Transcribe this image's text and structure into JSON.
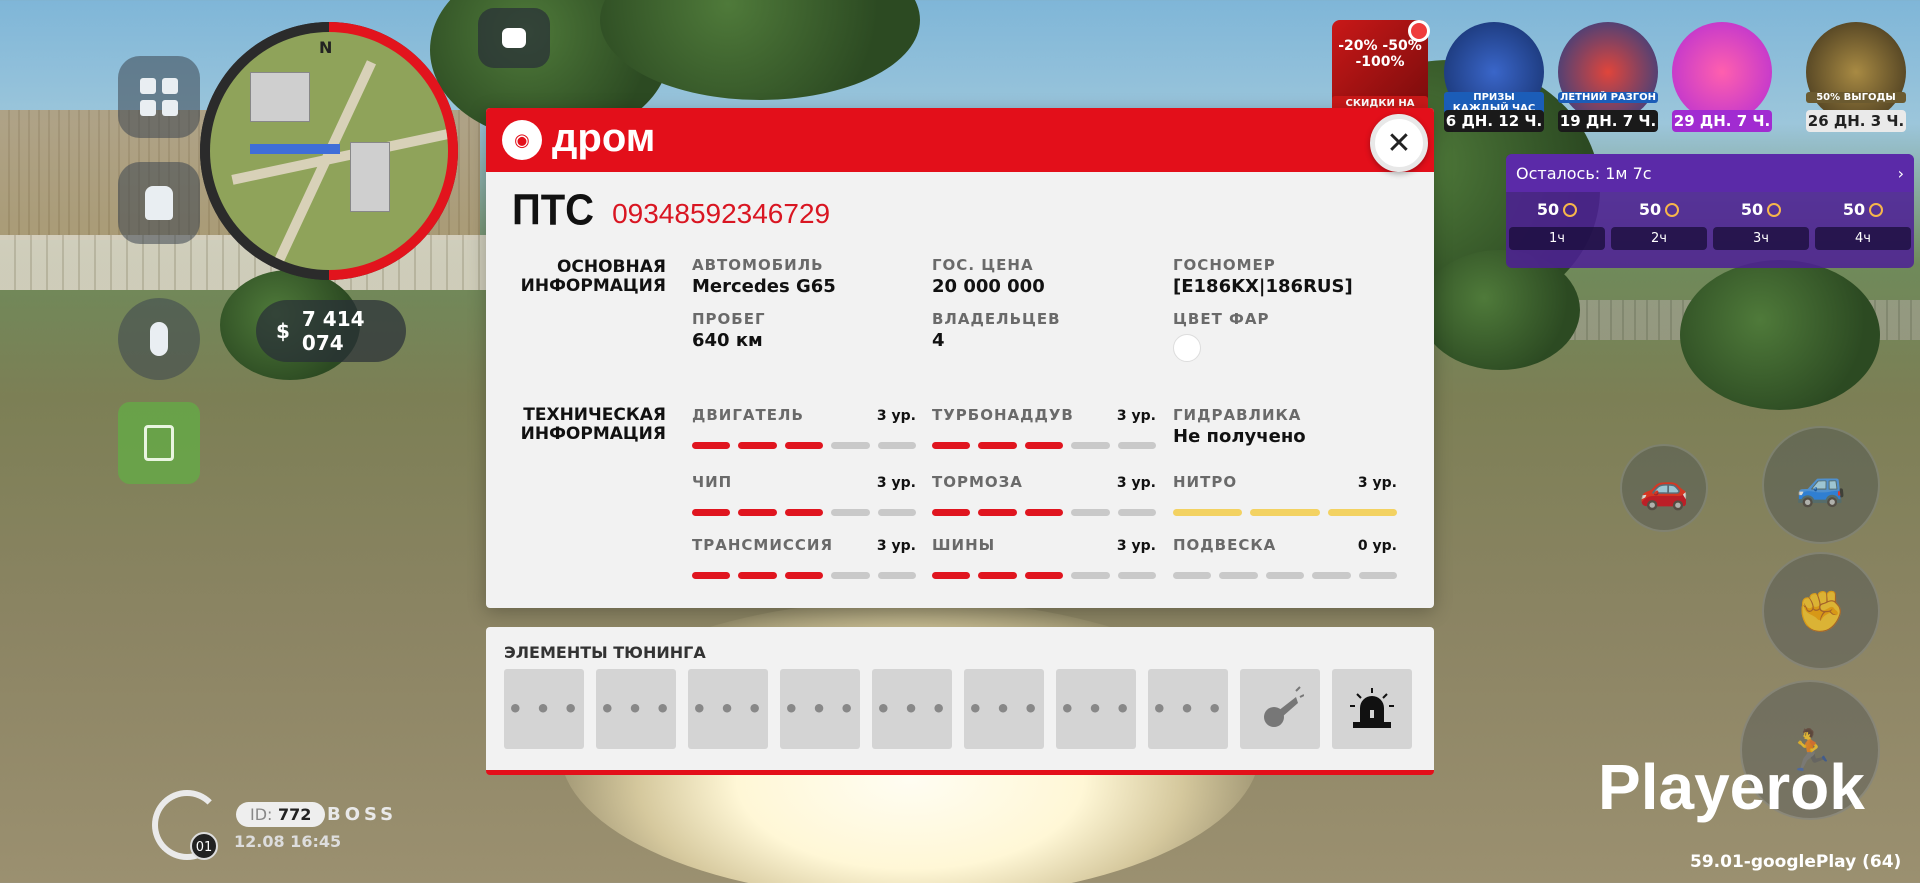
{
  "hud": {
    "money": "7 414 074",
    "money_symbol": "$",
    "minimap_north": "N",
    "player_id_label": "ID:",
    "player_id": "772",
    "player_name": "BOSS",
    "player_level": "01",
    "datetime": "12.08 16:45",
    "watermark": "Playerok",
    "version": "59.01-googlePlay (64)"
  },
  "events": [
    {
      "label": "СКИДКИ НА КЕЙСЫ",
      "promo": "-20% -50% -100%"
    },
    {
      "label": "ПРИЗЫ КАЖДЫЙ ЧАС",
      "time": "6 ДН. 12 Ч.",
      "color": "#1b3f8a"
    },
    {
      "label": "ЛЕТНИЙ РАЗГОН",
      "time": "19 ДН. 7 Ч.",
      "color": "#1b5db8"
    },
    {
      "label": "",
      "time": "29 ДН. 7 Ч.",
      "color": "#c53bd9"
    },
    {
      "label": "50% ВЫГОДЫ",
      "time": "26 ДН. 3 Ч.",
      "color": "#5a4a2a"
    }
  ],
  "timer": {
    "remaining_label": "Осталось:",
    "remaining_value": "1м 7с",
    "rewards": [
      {
        "amount": "50",
        "hour": "1ч"
      },
      {
        "amount": "50",
        "hour": "2ч"
      },
      {
        "amount": "50",
        "hour": "3ч"
      },
      {
        "amount": "50",
        "hour": "4ч"
      }
    ]
  },
  "panel": {
    "brand": "дром",
    "pts_label": "ПТС",
    "pts_number": "09348592346729",
    "basic_title_1": "ОСНОВНАЯ",
    "basic_title_2": "ИНФОРМАЦИЯ",
    "tech_title_1": "ТЕХНИЧЕСКАЯ",
    "tech_title_2": "ИНФОРМАЦИЯ",
    "basic": {
      "car_k": "АВТОМОБИЛЬ",
      "car_v": "Mercedes G65",
      "price_k": "ГОС. ЦЕНА",
      "price_v": "20 000 000",
      "plate_k": "ГОСНОМЕР",
      "plate_v": "[E186KX|186RUS]",
      "mileage_k": "ПРОБЕГ",
      "mileage_v": "640 км",
      "owners_k": "ВЛАДЕЛЬЦЕВ",
      "owners_v": "4",
      "lights_k": "ЦВЕТ ФАР",
      "lights_color": "#ffffff"
    },
    "tech": {
      "engine_k": "ДВИГАТЕЛЬ",
      "engine_lvl": "3 ур.",
      "engine_level": 3,
      "turbo_k": "ТУРБОНАДДУВ",
      "turbo_lvl": "3 ур.",
      "turbo_level": 3,
      "hydraulics_k": "ГИДРАВЛИКА",
      "hydraulics_v": "Не получено",
      "chip_k": "ЧИП",
      "chip_lvl": "3 ур.",
      "chip_level": 3,
      "brakes_k": "ТОРМОЗА",
      "brakes_lvl": "3 ур.",
      "brakes_level": 3,
      "nitro_k": "НИТРО",
      "nitro_lvl": "3 ур.",
      "nitro_level": 3,
      "trans_k": "ТРАНСМИССИЯ",
      "trans_lvl": "3 ур.",
      "trans_level": 3,
      "tires_k": "ШИНЫ",
      "tires_lvl": "3 ур.",
      "tires_level": 3,
      "susp_k": "ПОДВЕСКА",
      "susp_lvl": "0 ур.",
      "susp_level": 0
    },
    "accent_color": "#e30f1a"
  },
  "tuning": {
    "title": "ЭЛЕМЕНТЫ ТЮНИНГА",
    "slots": [
      "...",
      "...",
      "...",
      "...",
      "...",
      "...",
      "...",
      "...",
      "horn-icon",
      "siren-icon"
    ],
    "slot_empty_text": "• • •"
  }
}
